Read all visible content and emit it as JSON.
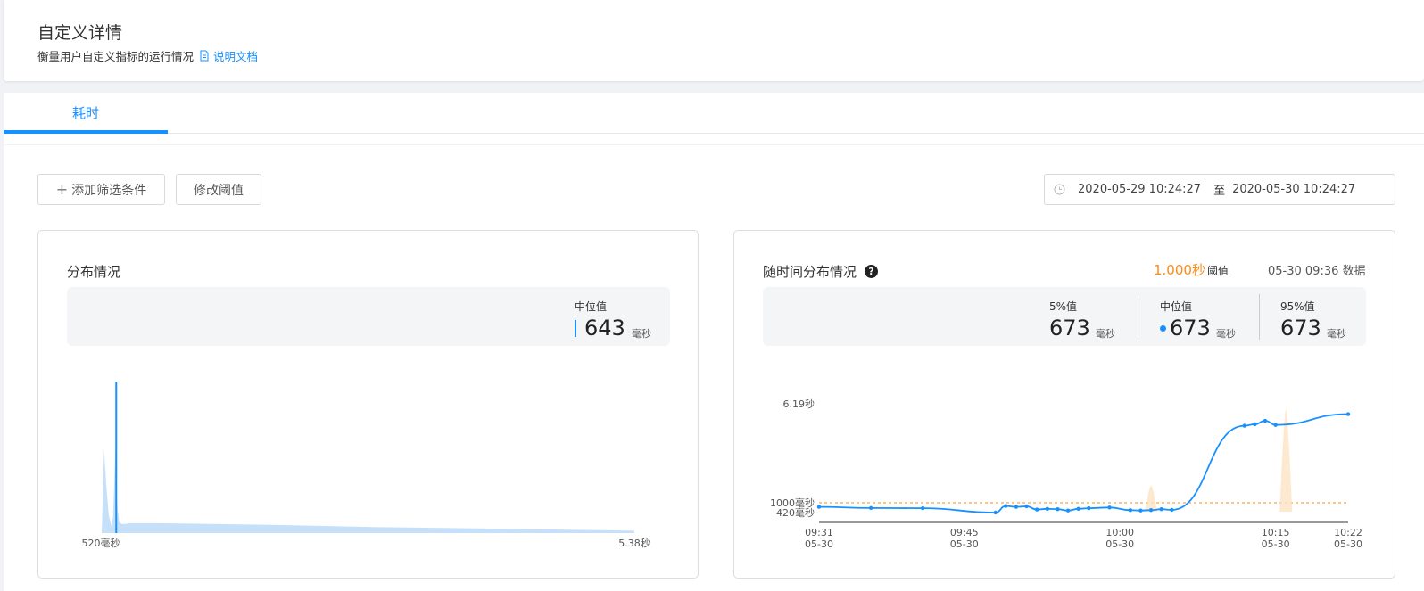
{
  "header": {
    "title": "自定义详情",
    "description": "衡量用户自定义指标的运行情况",
    "doc_link": "说明文档",
    "doc_icon": "document-icon"
  },
  "tabs": [
    {
      "label": "耗时",
      "active": true
    }
  ],
  "toolbar": {
    "add_filter_label": "添加筛选条件",
    "modify_threshold_label": "修改阈值"
  },
  "date_range": {
    "start": "2020-05-29 10:24:27",
    "separator": "至",
    "end": "2020-05-30 10:24:27",
    "icon": "clock-icon"
  },
  "distribution": {
    "title": "分布情况",
    "median_label": "中位值",
    "median_value": "643",
    "unit": "毫秒",
    "x_min_label": "520毫秒",
    "x_max_label": "5.38秒",
    "accent_color": "#1890ff",
    "fill_color": "#c6e0fa"
  },
  "time_distribution": {
    "title": "随时间分布情况",
    "help_icon": "question-circle-icon",
    "threshold_value": "1.000秒",
    "threshold_label": "阈值",
    "data_time": "05-30 09:36 数据",
    "stats": [
      {
        "label": "5%值",
        "value": "673",
        "unit": "毫秒"
      },
      {
        "label": "中位值",
        "value": "673",
        "unit": "毫秒"
      },
      {
        "label": "95%值",
        "value": "673",
        "unit": "毫秒"
      }
    ],
    "threshold_color": "#fa8c16"
  },
  "chart_data": [
    {
      "type": "area",
      "title": "分布情况",
      "x_range_labels": [
        "520毫秒",
        "5.38秒"
      ],
      "x_range_ms": [
        520,
        5380
      ],
      "median_marker_ms": 643,
      "series": [
        {
          "x": [
            520,
            540,
            560,
            580,
            600,
            615,
            625,
            635,
            643,
            655,
            670,
            690,
            720,
            760,
            800,
            1000,
            2000,
            3000,
            4000,
            5000,
            5380
          ],
          "values": [
            0,
            0.55,
            0.3,
            0.12,
            0.05,
            0.1,
            0.3,
            0.55,
            0.3,
            0.15,
            0.07,
            0.06,
            0.06,
            0.065,
            0.065,
            0.065,
            0.055,
            0.04,
            0.03,
            0.02,
            0.015
          ]
        }
      ]
    },
    {
      "type": "line",
      "title": "随时间分布情况",
      "y_tick_labels": [
        "420毫秒",
        "1000毫秒",
        "6.19秒"
      ],
      "x_tick_labels": [
        {
          "time": "09:31",
          "date": "05-30"
        },
        {
          "time": "09:45",
          "date": "05-30"
        },
        {
          "time": "10:00",
          "date": "05-30"
        },
        {
          "time": "10:15",
          "date": "05-30"
        },
        {
          "time": "10:22",
          "date": "05-30"
        }
      ],
      "threshold_ms": 1000,
      "series": [
        {
          "x": [
            "09:31",
            "09:36",
            "09:41",
            "09:48",
            "09:49",
            "09:50",
            "09:51",
            "09:52",
            "09:53",
            "09:54",
            "09:55",
            "09:56",
            "09:57",
            "09:59",
            "10:01",
            "10:02",
            "10:03",
            "10:04",
            "10:05",
            "10:12",
            "10:13",
            "10:14",
            "10:15",
            "10:22"
          ],
          "values": [
            760,
            690,
            680,
            420,
            810,
            760,
            790,
            600,
            640,
            620,
            540,
            640,
            680,
            720,
            560,
            540,
            570,
            620,
            580,
            5040,
            5120,
            5300,
            5080,
            5650
          ]
        }
      ]
    }
  ]
}
